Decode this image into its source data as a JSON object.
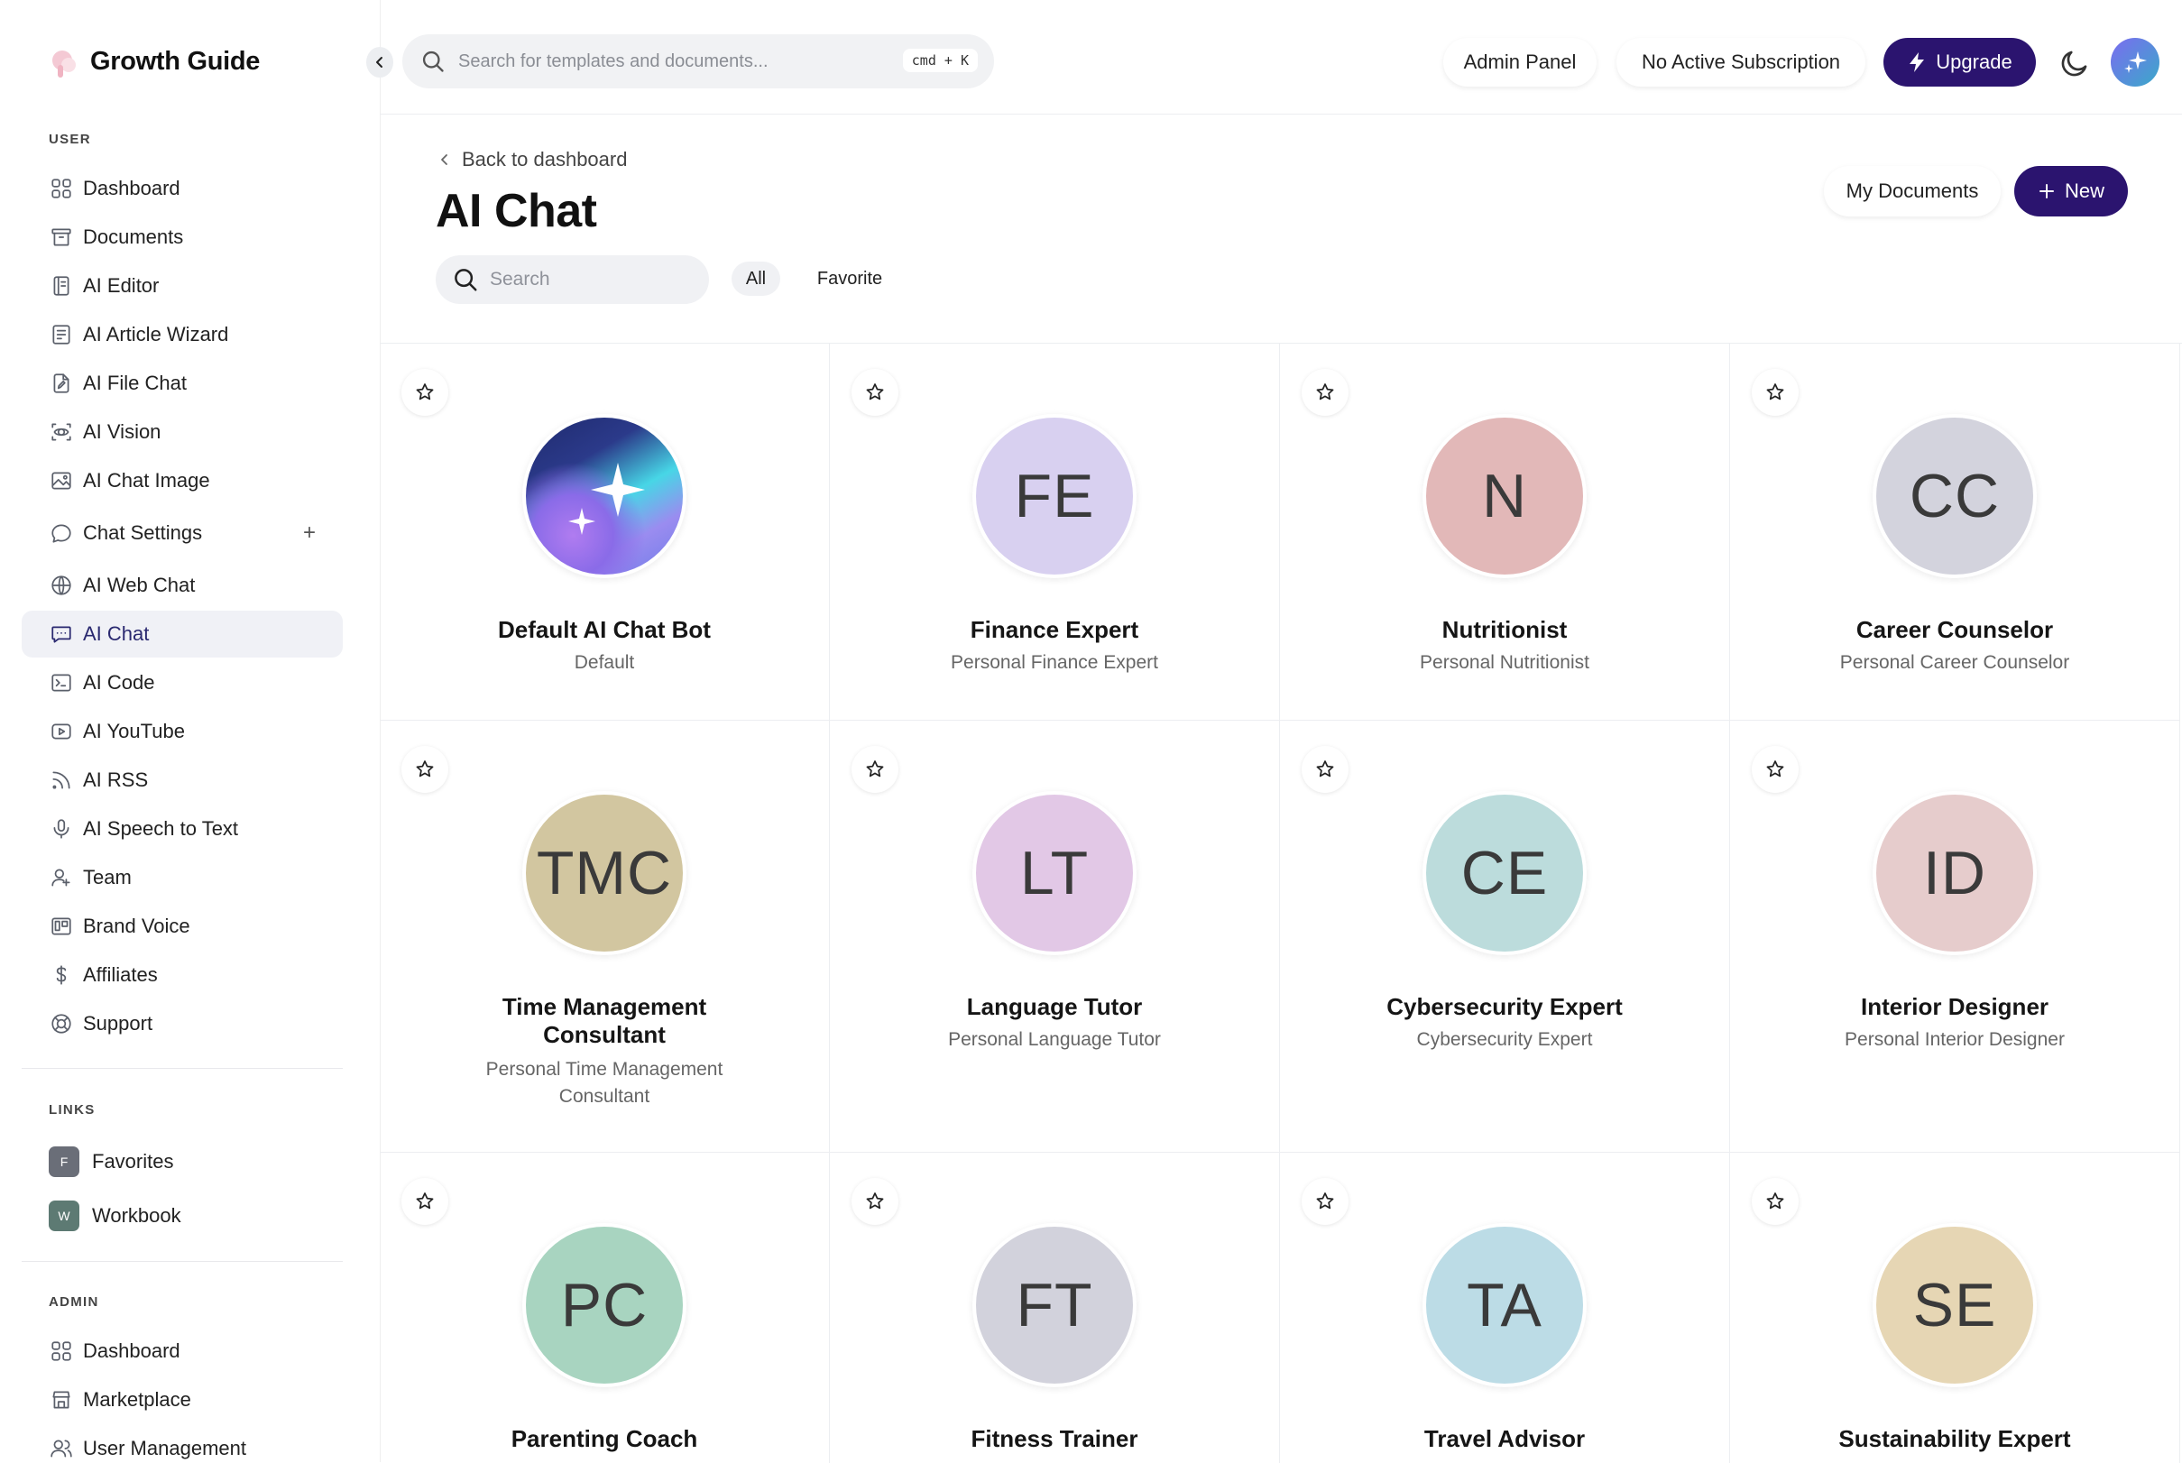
{
  "app": {
    "name": "Growth Guide"
  },
  "header": {
    "search_placeholder": "Search for templates and documents...",
    "shortcut": "cmd + K",
    "admin_panel": "Admin Panel",
    "subscription": "No Active Subscription",
    "upgrade": "Upgrade"
  },
  "sidebar": {
    "user_label": "USER",
    "user_items": [
      {
        "label": "Dashboard",
        "icon": "grid-icon"
      },
      {
        "label": "Documents",
        "icon": "archive-icon"
      },
      {
        "label": "AI Editor",
        "icon": "notebook-icon"
      },
      {
        "label": "AI Article Wizard",
        "icon": "article-icon"
      },
      {
        "label": "AI File Chat",
        "icon": "file-edit-icon"
      },
      {
        "label": "AI Vision",
        "icon": "scan-eye-icon"
      },
      {
        "label": "AI Chat Image",
        "icon": "image-icon"
      },
      {
        "label": "Chat Settings",
        "icon": "chat-bubble-icon"
      },
      {
        "label": "AI Web Chat",
        "icon": "www-icon"
      },
      {
        "label": "AI Chat",
        "icon": "chat-dots-icon"
      },
      {
        "label": "AI Code",
        "icon": "terminal-icon"
      },
      {
        "label": "AI YouTube",
        "icon": "play-icon"
      },
      {
        "label": "AI RSS",
        "icon": "rss-icon"
      },
      {
        "label": "AI Speech to Text",
        "icon": "mic-icon"
      },
      {
        "label": "Team",
        "icon": "user-plus-icon"
      },
      {
        "label": "Brand Voice",
        "icon": "layout-icon"
      },
      {
        "label": "Affiliates",
        "icon": "dollar-icon"
      },
      {
        "label": "Support",
        "icon": "lifebuoy-icon"
      }
    ],
    "links_label": "LINKS",
    "links": [
      {
        "label": "Favorites",
        "badge": "F",
        "color": "#6a6e78"
      },
      {
        "label": "Workbook",
        "badge": "W",
        "color": "#5d7a73"
      }
    ],
    "admin_label": "ADMIN",
    "admin_items": [
      {
        "label": "Dashboard",
        "icon": "grid-icon"
      },
      {
        "label": "Marketplace",
        "icon": "store-icon"
      },
      {
        "label": "User Management",
        "icon": "users-icon"
      }
    ]
  },
  "page": {
    "back": "Back to dashboard",
    "title": "AI Chat",
    "search_placeholder": "Search",
    "filters": [
      "All",
      "Favorite"
    ],
    "my_documents": "My Documents",
    "new": "New"
  },
  "cards": [
    {
      "initials": "",
      "name": "Default AI Chat Bot",
      "subtitle": "Default",
      "color": "#6d6ad9"
    },
    {
      "initials": "FE",
      "name": "Finance Expert",
      "subtitle": "Personal Finance Expert",
      "color": "#d8d0f0"
    },
    {
      "initials": "N",
      "name": "Nutritionist",
      "subtitle": "Personal Nutritionist",
      "color": "#e2b8b8"
    },
    {
      "initials": "CC",
      "name": "Career Counselor",
      "subtitle": "Personal Career Counselor",
      "color": "#d3d3dd"
    },
    {
      "initials": "TMC",
      "name": "Time Management Consultant",
      "subtitle": "Personal Time Management Consultant",
      "color": "#d2c6a0"
    },
    {
      "initials": "LT",
      "name": "Language Tutor",
      "subtitle": "Personal Language Tutor",
      "color": "#e2c8e6"
    },
    {
      "initials": "CE",
      "name": "Cybersecurity Expert",
      "subtitle": "Cybersecurity Expert",
      "color": "#bcdcdc"
    },
    {
      "initials": "ID",
      "name": "Interior Designer",
      "subtitle": "Personal Interior Designer",
      "color": "#e6cccc"
    },
    {
      "initials": "PC",
      "name": "Parenting Coach",
      "subtitle": "",
      "color": "#a8d4c0"
    },
    {
      "initials": "FT",
      "name": "Fitness Trainer",
      "subtitle": "",
      "color": "#d2d2dc"
    },
    {
      "initials": "TA",
      "name": "Travel Advisor",
      "subtitle": "",
      "color": "#bcdce6"
    },
    {
      "initials": "SE",
      "name": "Sustainability Expert",
      "subtitle": "",
      "color": "#e6d6b4"
    }
  ]
}
